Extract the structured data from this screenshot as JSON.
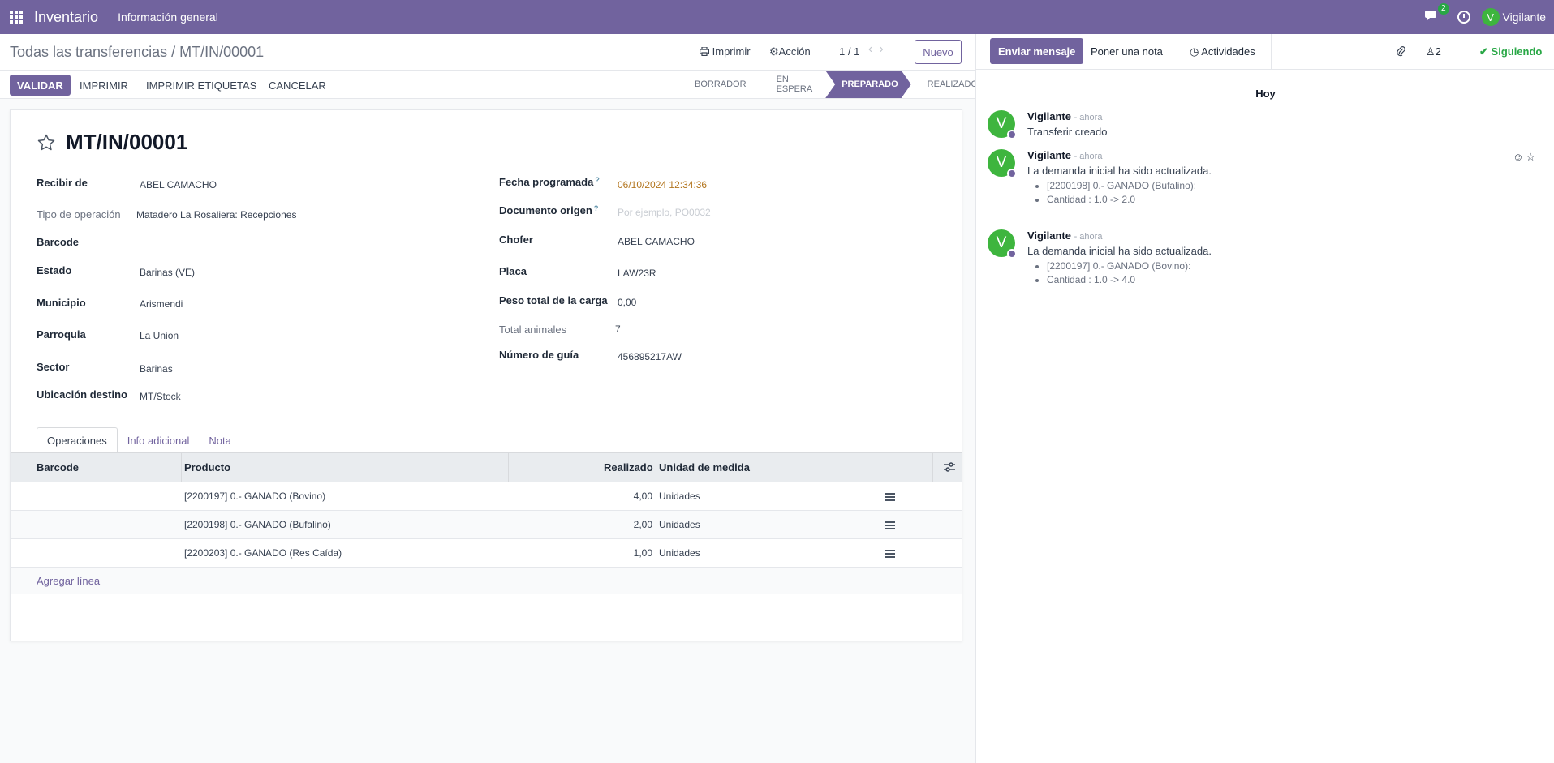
{
  "topbar": {
    "app_name": "Inventario",
    "menu": "Información general",
    "chat_count": "2",
    "user_initial": "V",
    "user_name": "Vigilante"
  },
  "control": {
    "breadcrumb_parent": "Todas las transferencias",
    "breadcrumb_sep": "/",
    "breadcrumb_current": "MT/IN/00001",
    "print": "Imprimir",
    "action": "Acción",
    "pager": "1 / 1",
    "new": "Nuevo"
  },
  "actions": {
    "validate": "VALIDAR",
    "print": "IMPRIMIR",
    "print_labels": "IMPRIMIR ETIQUETAS",
    "cancel": "CANCELAR"
  },
  "statusbar": [
    "BORRADOR",
    "EN ESPERA",
    "PREPARADO",
    "REALIZADO"
  ],
  "statusbar_active": "PREPARADO",
  "record": {
    "title": "MT/IN/00001",
    "left_fields": [
      {
        "label": "Recibir de",
        "value": "ABEL CAMACHO"
      },
      {
        "label": "Tipo de operación",
        "value": "Matadero La Rosaliera: Recepciones"
      },
      {
        "label": "Barcode",
        "value": ""
      },
      {
        "label": "Estado",
        "value": "Barinas (VE)"
      },
      {
        "label": "Municipio",
        "value": "Arismendi"
      },
      {
        "label": "Parroquia",
        "value": "La Union"
      },
      {
        "label": "Sector",
        "value": "Barinas"
      },
      {
        "label": "Ubicación destino",
        "value": "MT/Stock"
      }
    ],
    "right_fields": [
      {
        "label": "Fecha programada",
        "value": "06/10/2024 12:34:36",
        "help": "?"
      },
      {
        "label": "Documento origen",
        "value": "",
        "placeholder": "Por ejemplo, PO0032",
        "help": "?"
      },
      {
        "label": "Chofer",
        "value": "ABEL CAMACHO"
      },
      {
        "label": "Placa",
        "value": "LAW23R"
      },
      {
        "label": "Peso total de la carga",
        "value": "0,00"
      },
      {
        "label": "Total animales",
        "value": "7"
      },
      {
        "label": "Número de guía",
        "value": "456895217AW"
      }
    ]
  },
  "tabs": [
    "Operaciones",
    "Info adicional",
    "Nota"
  ],
  "table": {
    "headers": {
      "barcode": "Barcode",
      "product": "Producto",
      "done": "Realizado",
      "uom": "Unidad de medida"
    },
    "rows": [
      {
        "barcode": "",
        "product": "[2200197] 0.- GANADO (Bovino)",
        "done": "4,00",
        "uom": "Unidades"
      },
      {
        "barcode": "",
        "product": "[2200198] 0.- GANADO (Bufalino)",
        "done": "2,00",
        "uom": "Unidades"
      },
      {
        "barcode": "",
        "product": "[2200203] 0.- GANADO (Res Caída)",
        "done": "1,00",
        "uom": "Unidades"
      }
    ],
    "add_line": "Agregar línea"
  },
  "chatter": {
    "send_message": "Enviar mensaje",
    "log_note": "Poner una nota",
    "activities": "Actividades",
    "followers": "2",
    "following": "Siguiendo",
    "day": "Hoy",
    "messages": [
      {
        "author": "Vigilante",
        "time": "- ahora",
        "text": "Transferir creado",
        "items": []
      },
      {
        "author": "Vigilante",
        "time": "- ahora",
        "text": "La demanda inicial ha sido actualizada.",
        "items": [
          "[2200198] 0.- GANADO (Bufalino):",
          "Cantidad : 1.0 -> 2.0"
        ]
      },
      {
        "author": "Vigilante",
        "time": "- ahora",
        "text": "La demanda inicial ha sido actualizada.",
        "items": [
          "[2200197] 0.- GANADO (Bovino):",
          "Cantidad : 1.0 -> 4.0"
        ]
      }
    ]
  },
  "colors": {
    "brand": "#71639e",
    "success": "#28a745",
    "date": "#b3761f"
  }
}
